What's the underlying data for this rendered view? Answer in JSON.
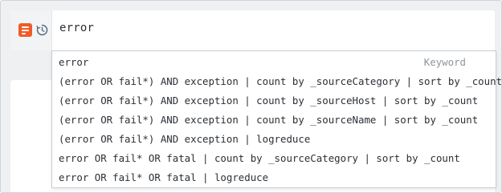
{
  "search": {
    "query": "error",
    "icons": [
      "log-search-icon",
      "history-icon"
    ]
  },
  "suggestions": [
    {
      "text": "error",
      "tag": "Keyword"
    },
    {
      "text": "(error OR fail*) AND exception | count by _sourceCategory | sort by _count"
    },
    {
      "text": "(error OR fail*) AND exception | count by _sourceHost | sort by _count"
    },
    {
      "text": "(error OR fail*) AND exception | count by _sourceName | sort by _count"
    },
    {
      "text": "(error OR fail*) AND exception | logreduce"
    },
    {
      "text": "error OR fail* OR fatal | count by _sourceCategory | sort by _count"
    },
    {
      "text": "error OR fail* OR fatal | logreduce"
    }
  ],
  "colors": {
    "accent": "#f05a28",
    "history_icon": "#5a6b80"
  }
}
